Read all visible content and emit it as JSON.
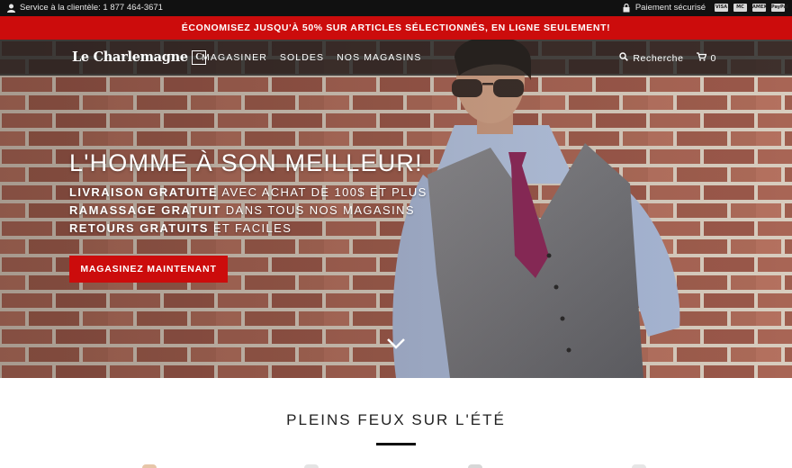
{
  "utility_bar": {
    "service_text": "Service à la clientèle: 1 877 464-3671",
    "secure_text": "Paiement sécurisé",
    "cards": [
      "VISA",
      "MC",
      "AMEX",
      "PayPal"
    ]
  },
  "promo": {
    "text": "ÉCONOMISEZ JUSQU'À 50% SUR ARTICLES SÉLECTIONNÉS, EN LIGNE SEULEMENT!"
  },
  "nav": {
    "logo": "Le Charlemagne",
    "logo_mark": "C",
    "items": [
      "MAGASINER",
      "SOLDES",
      "NOS MAGASINS"
    ],
    "search_label": "Recherche",
    "cart_count": "0"
  },
  "hero": {
    "title": "L'HOMME À SON MEILLEUR!",
    "lines": [
      {
        "bold": "LIVRAISON GRATUITE",
        "rest": " AVEC ACHAT DE 100$ ET PLUS"
      },
      {
        "bold": "RAMASSAGE GRATUIT",
        "rest": " DANS TOUS NOS MAGASINS"
      },
      {
        "bold": "RETOURS GRATUITS",
        "rest": " ET FACILES"
      }
    ],
    "cta": "MAGASINEZ MAINTENANT"
  },
  "section": {
    "title": "PLEINS FEUX SUR L'ÉTÉ"
  },
  "colors": {
    "accent": "#cc0c0c",
    "utility_bg": "#111111",
    "nav_bg": "#1e1e1e"
  },
  "icons": [
    "user-icon",
    "lock-icon",
    "search-icon",
    "cart-icon",
    "chevron-down-icon"
  ]
}
